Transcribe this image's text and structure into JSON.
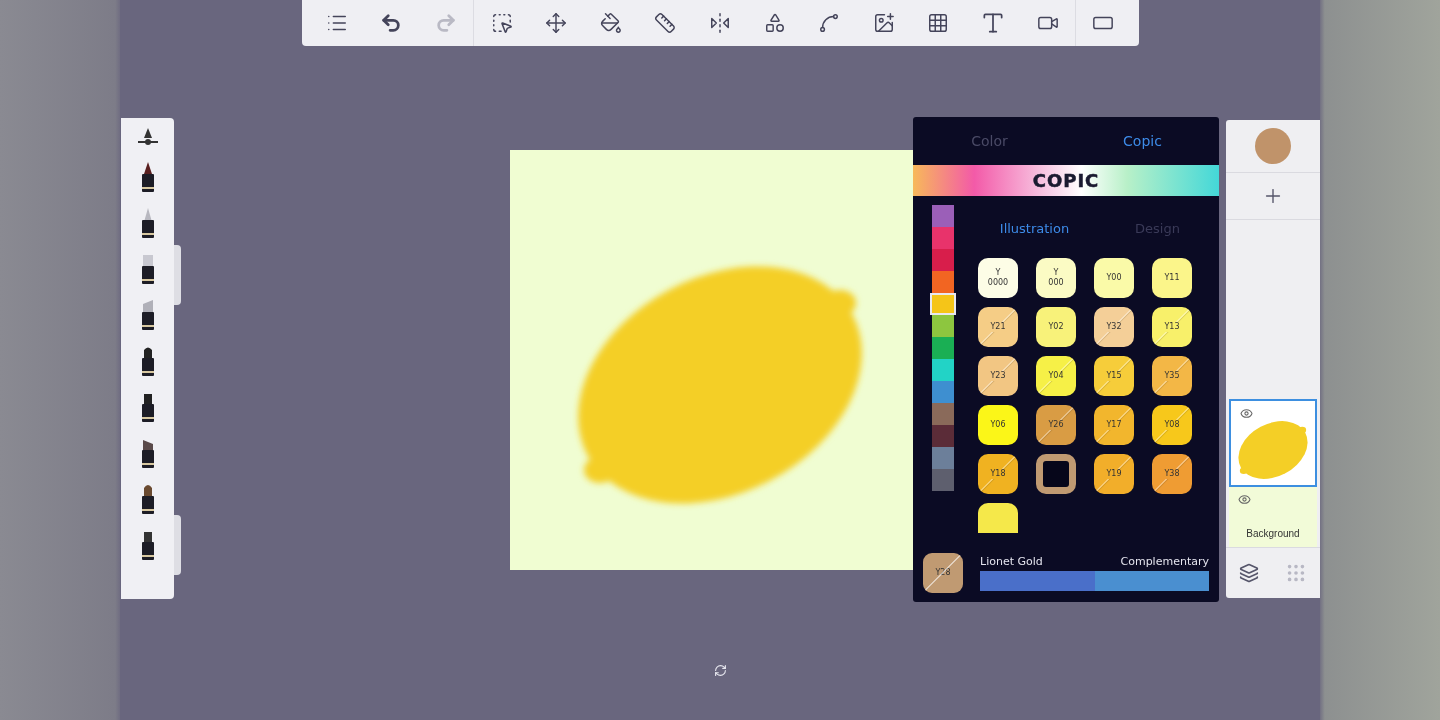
{
  "toolbar": {
    "items": [
      {
        "kind": "list",
        "disabled": false
      },
      {
        "kind": "undo",
        "disabled": false
      },
      {
        "kind": "redo",
        "disabled": true
      },
      {
        "kind": "select",
        "disabled": false
      },
      {
        "kind": "move",
        "disabled": false
      },
      {
        "kind": "bucket",
        "disabled": false
      },
      {
        "kind": "ruler",
        "disabled": false
      },
      {
        "kind": "symmetry",
        "disabled": false
      },
      {
        "kind": "shapes",
        "disabled": false
      },
      {
        "kind": "curve",
        "disabled": false
      },
      {
        "kind": "image",
        "disabled": false
      },
      {
        "kind": "perspective",
        "disabled": false
      },
      {
        "kind": "text",
        "disabled": false
      },
      {
        "kind": "video",
        "disabled": false
      },
      {
        "kind": "frame",
        "disabled": false
      }
    ]
  },
  "color_panel": {
    "tabs": [
      {
        "label": "Color",
        "selected": false
      },
      {
        "label": "Copic",
        "selected": true
      }
    ],
    "logo": "COPIC",
    "hue_strip": [
      {
        "color": "#9b5fb8",
        "selected": false
      },
      {
        "color": "#e8336b",
        "selected": false
      },
      {
        "color": "#d81e4b",
        "selected": false
      },
      {
        "color": "#f26522",
        "selected": false
      },
      {
        "color": "#f5c518",
        "selected": true
      },
      {
        "color": "#8dc63f",
        "selected": false
      },
      {
        "color": "#1aaf54",
        "selected": false
      },
      {
        "color": "#22d3c6",
        "selected": false
      },
      {
        "color": "#3e8fd0",
        "selected": false
      },
      {
        "color": "#8a6a5a",
        "selected": false
      },
      {
        "color": "#5b2c38",
        "selected": false
      },
      {
        "color": "#6c7f9a",
        "selected": false
      },
      {
        "color": "#5e5f6e",
        "selected": false
      }
    ],
    "sub_tabs": [
      {
        "label": "Illustration",
        "selected": true
      },
      {
        "label": "Design",
        "selected": false
      }
    ],
    "swatches": [
      {
        "label": "Y 0000",
        "color": "#fdfde6",
        "slashed": false,
        "selected": false
      },
      {
        "label": "Y 000",
        "color": "#fbfbc4",
        "slashed": false,
        "selected": false
      },
      {
        "label": "Y00",
        "color": "#fafaa8",
        "slashed": false,
        "selected": false
      },
      {
        "label": "Y11",
        "color": "#fbf58a",
        "slashed": false,
        "selected": false
      },
      {
        "label": "Y21",
        "color": "#f5cd86",
        "slashed": true,
        "selected": false
      },
      {
        "label": "Y02",
        "color": "#f8f27a",
        "slashed": false,
        "selected": false
      },
      {
        "label": "Y32",
        "color": "#f4cf98",
        "slashed": true,
        "selected": false
      },
      {
        "label": "Y13",
        "color": "#f8f06a",
        "slashed": true,
        "selected": false
      },
      {
        "label": "Y23",
        "color": "#f2c683",
        "slashed": true,
        "selected": false
      },
      {
        "label": "Y04",
        "color": "#f6f047",
        "slashed": true,
        "selected": false
      },
      {
        "label": "Y15",
        "color": "#f6cd3a",
        "slashed": true,
        "selected": false
      },
      {
        "label": "Y35",
        "color": "#f3b746",
        "slashed": true,
        "selected": false
      },
      {
        "label": "Y06",
        "color": "#fbf618",
        "slashed": false,
        "selected": false
      },
      {
        "label": "Y26",
        "color": "#d99c44",
        "slashed": true,
        "selected": false
      },
      {
        "label": "Y17",
        "color": "#f2b62d",
        "slashed": true,
        "selected": false
      },
      {
        "label": "Y08",
        "color": "#f7c81b",
        "slashed": true,
        "selected": false
      },
      {
        "label": "Y18",
        "color": "#f0b221",
        "slashed": true,
        "selected": false
      },
      {
        "color": "#c09a72",
        "slashed": false,
        "selected": true
      },
      {
        "label": "Y19",
        "color": "#f2ae2a",
        "slashed": true,
        "selected": false
      },
      {
        "label": "Y38",
        "color": "#ef9c33",
        "slashed": true,
        "selected": false
      },
      {
        "color": "#f5e84a",
        "slashed": false,
        "selected": false
      }
    ],
    "current": {
      "label": "Y28",
      "color": "#c09a72",
      "name": "Lionet Gold",
      "complementary_label": "Complementary",
      "complementary": [
        {
          "color": "#4a6fc9"
        },
        {
          "color": "#4a8fd0"
        }
      ]
    }
  },
  "layers_panel": {
    "current_color": {
      "color": "#c0936a"
    },
    "layers": [
      {
        "kind": "drawing",
        "selected": true
      },
      {
        "kind": "background",
        "label": "Background",
        "selected": false
      }
    ]
  }
}
